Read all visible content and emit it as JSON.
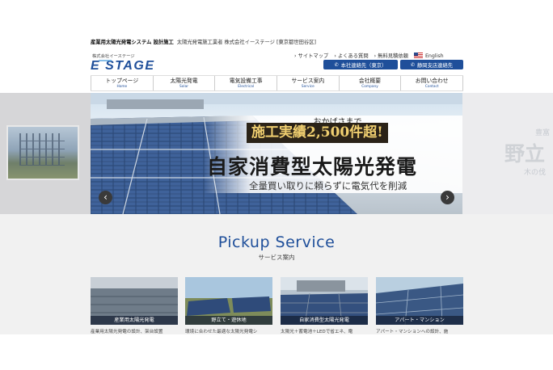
{
  "header": {
    "tagline_bold": "産業用太陽光発電システム 設計施工",
    "tagline_rest": "太陽光発電施工業者 株式会社イーステージ [東京都世田谷区]",
    "logo_sub": "株式会社イーステージ",
    "logo_text": "E STAGE",
    "util_links": [
      "サイトマップ",
      "よくある質問",
      "無料見積依頼"
    ],
    "english_label": "English",
    "contact_tokyo": "本社連絡先（東京）",
    "contact_shizuoka": "静岡支店連絡先"
  },
  "nav": [
    {
      "jp": "トップページ",
      "en": "Home"
    },
    {
      "jp": "太陽光発電",
      "en": "Solar"
    },
    {
      "jp": "電気設備工事",
      "en": "Electrical"
    },
    {
      "jp": "サービス案内",
      "en": "Service"
    },
    {
      "jp": "会社概要",
      "en": "Company"
    },
    {
      "jp": "お問い合わせ",
      "en": "Contact"
    }
  ],
  "hero": {
    "okage": "おかげさまで",
    "jisseki": "施工実績2,500件超!",
    "main_copy": "自家消費型太陽光発電",
    "sub_copy": "全量買い取りに頼らずに電気代を削減",
    "prev_arrow": "‹",
    "next_arrow": "›",
    "right_peek_1": "豊富",
    "right_peek_2": "野立",
    "right_peek_3": "木の伐"
  },
  "services": {
    "title": "Pickup Service",
    "subtitle": "サービス案内",
    "cards": [
      {
        "label": "産業用太陽光発電",
        "desc": "産業用太陽光発電の設計、架台設置"
      },
      {
        "label": "野立て・遊休地",
        "desc": "環境に合わせた最適な太陽光発電シ"
      },
      {
        "label": "自家消費型太陽光発電",
        "desc": "太陽光＋蓄電池＋LEDで省エネ、電"
      },
      {
        "label": "アパート・マンション",
        "desc": "アパート・マンションへの設計、施"
      }
    ]
  },
  "colors": {
    "brand_blue": "#1f4f9a",
    "button_blue": "#1f4f9a",
    "dark_banner": "#2b2318",
    "gold_text": "#f0cf70"
  }
}
